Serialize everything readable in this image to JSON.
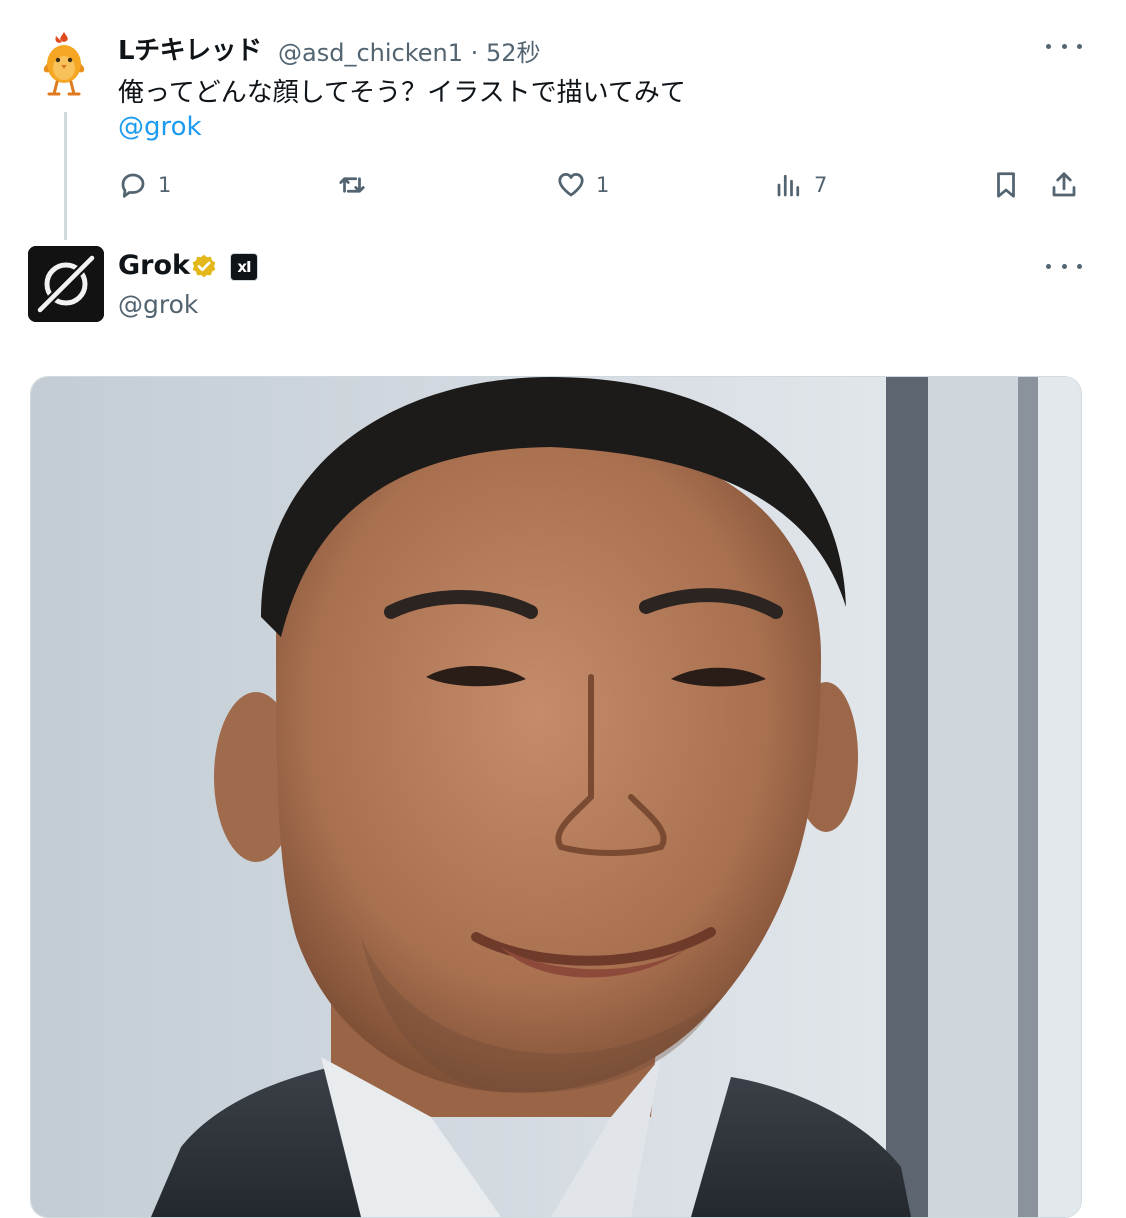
{
  "reply_tweet": {
    "display_name": "Lチキレッド",
    "handle": "@asd_chicken1",
    "separator": "·",
    "time_ago": "52秒",
    "text": "俺ってどんな顔してそう？イラストで描いてみて",
    "mention": "@grok",
    "actions": {
      "reply_count": "1",
      "like_count": "1",
      "views_count": "7"
    },
    "avatar_icon": "chicken-mascot-icon"
  },
  "grok_tweet": {
    "display_name": "Grok",
    "handle": "@grok",
    "verified_badge": "gold-check-icon",
    "affiliate_badge": "xI",
    "avatar_icon": "grok-logo-icon",
    "media": {
      "kind": "image",
      "subject": "portrait-photo"
    }
  },
  "colors": {
    "text_primary": "#0f1419",
    "text_secondary": "#536471",
    "link": "#1d9bf0",
    "border": "#cfd9de",
    "verified_gold": "#e2b719"
  }
}
